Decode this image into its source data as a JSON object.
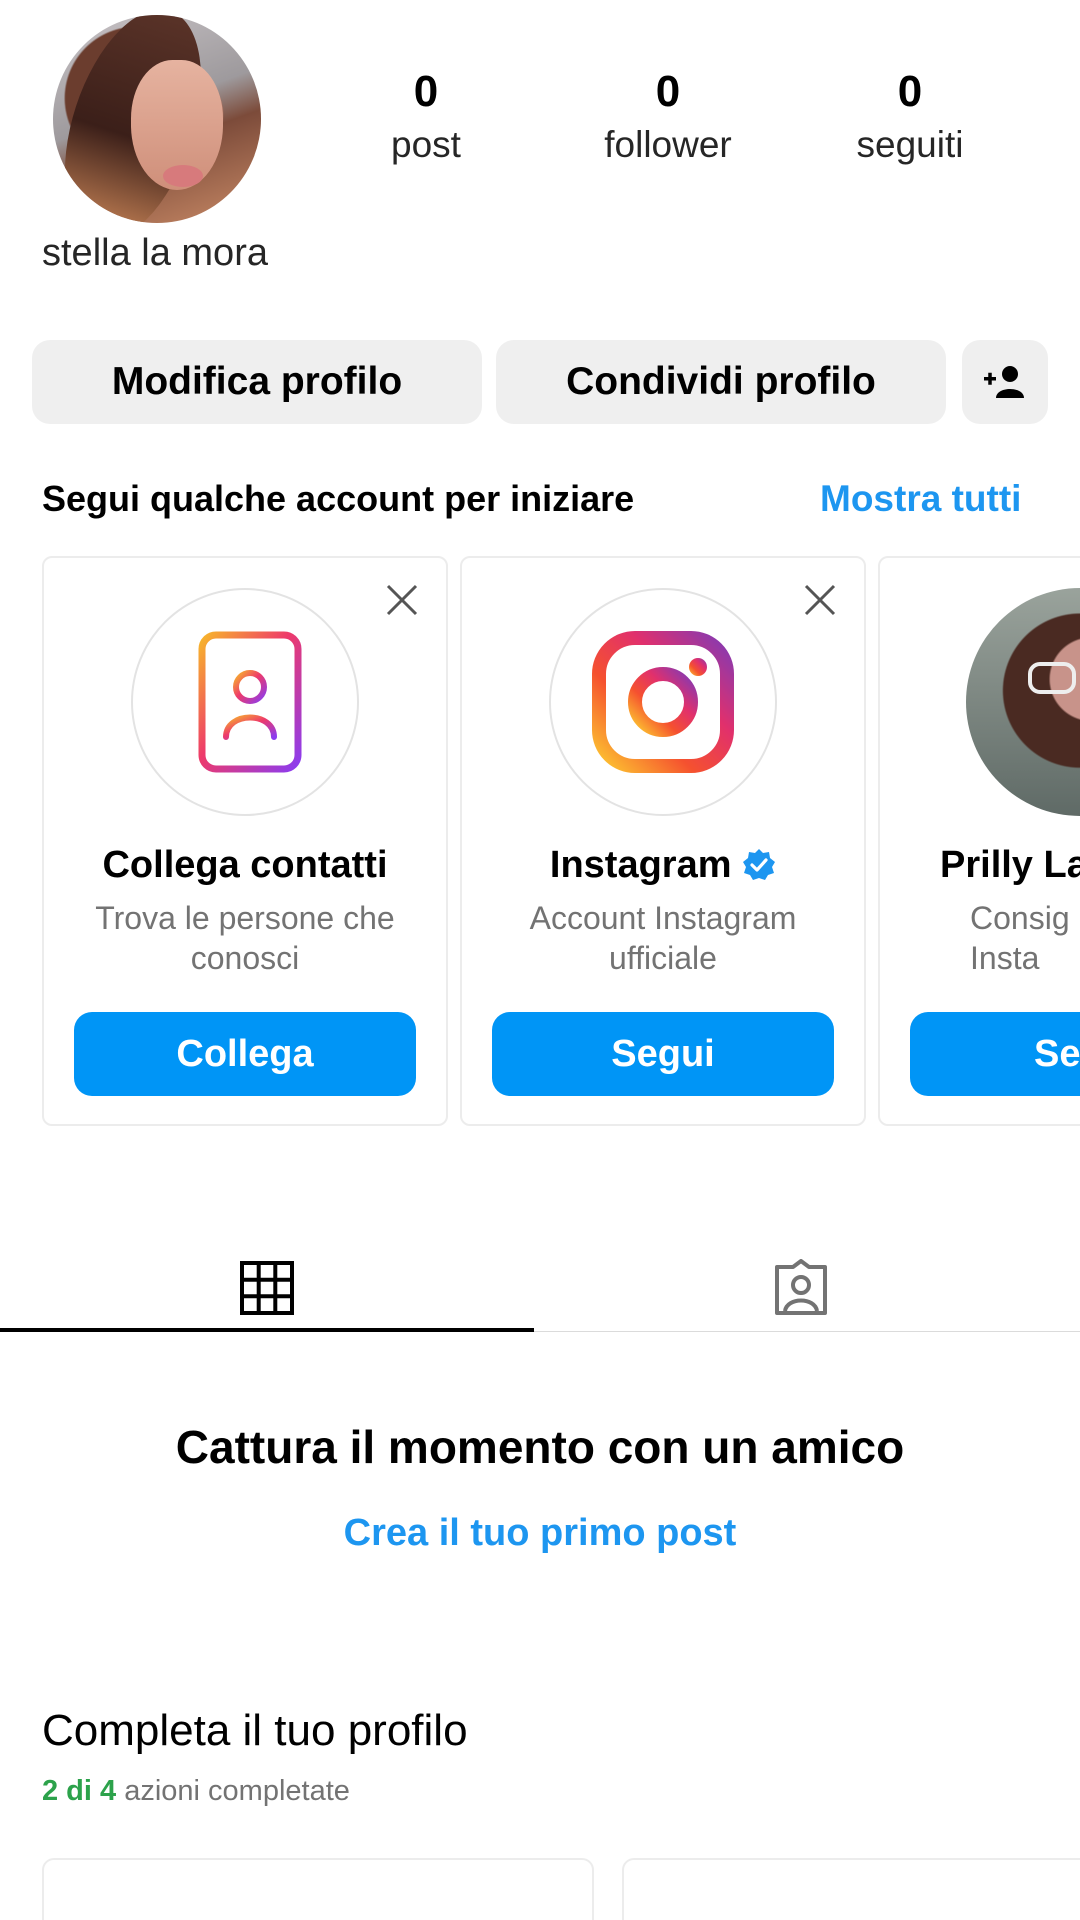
{
  "profile": {
    "username": "stella la mora",
    "stats": [
      {
        "count": "0",
        "label": "post"
      },
      {
        "count": "0",
        "label": "follower"
      },
      {
        "count": "0",
        "label": "seguiti"
      }
    ]
  },
  "actions": {
    "edit": "Modifica profilo",
    "share": "Condividi profilo"
  },
  "suggestions": {
    "title": "Segui qualche account per iniziare",
    "show_all": "Mostra tutti",
    "cards": [
      {
        "title": "Collega contatti",
        "subtitle": "Trova le persone che conosci",
        "button": "Collega"
      },
      {
        "title": "Instagram",
        "subtitle": "Account Instagram ufficiale",
        "button": "Segui"
      },
      {
        "title": "Prilly La",
        "subtitle": "Consig Insta",
        "button": "Se"
      }
    ]
  },
  "empty": {
    "title": "Cattura il momento con un amico",
    "link": "Crea il tuo primo post"
  },
  "complete": {
    "title": "Completa il tuo profilo",
    "progress": "2 di 4",
    "suffix": "azioni completate"
  },
  "colors": {
    "accent": "#0095f6",
    "link": "#1d96f0",
    "verified": "#1d96f0",
    "progress_green": "#2ca24b"
  }
}
